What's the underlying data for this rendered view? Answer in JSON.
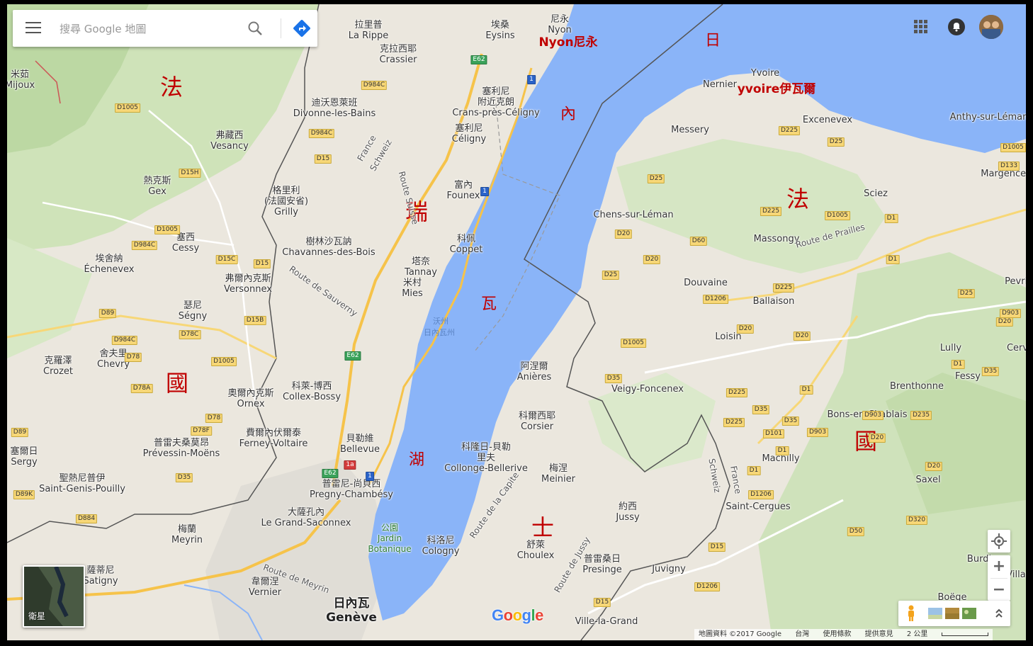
{
  "search": {
    "placeholder": "搜尋 Google 地圖"
  },
  "annotations": {
    "france_left_1": "法",
    "france_left_2": "國",
    "swiss_1": "瑞",
    "swiss_2": "士",
    "geneva_1": "日",
    "geneva_2": "內",
    "geneva_3": "瓦",
    "geneva_4": "湖",
    "france_right_1": "法",
    "france_right_2": "國",
    "nyon": "Nyon尼永",
    "yvoire": "yvoire伊瓦爾"
  },
  "places": {
    "geneva_zh": "日內瓦",
    "geneva": "Genève",
    "nyon_zh": "尼永",
    "nyon": "Nyon",
    "laripe_zh": "拉里普",
    "laripe": "La Rippe",
    "crassier_zh": "克拉西耶",
    "crassier": "Crassier",
    "eysins_zh": "埃桑",
    "eysins": "Eysins",
    "mijoux_zh": "米茹",
    "mijoux": "Mijoux",
    "divonne_zh": "迪沃恩萊班",
    "divonne": "Divonne-les-Bains",
    "crans_zh1": "塞利尼",
    "crans_zh2": "附近克朗",
    "crans": "Crans-près-Céligny",
    "celigny_zh": "塞利尼",
    "celigny": "Céligny",
    "vesancy_zh": "弗藏西",
    "vesancy": "Vesancy",
    "gex_zh": "熱克斯",
    "gex": "Gex",
    "grilly_zh1": "格里利",
    "grilly_zh2": "(法國安省)",
    "grilly": "Grilly",
    "founex_zh": "富內",
    "founex": "Founex",
    "cessy_zh": "塞西",
    "cessy": "Cessy",
    "chavannes_zh": "樹林沙瓦訥",
    "chavannes": "Chavannes-des-Bois",
    "coppet_zh": "科佩",
    "coppet": "Coppet",
    "echenevex_zh": "埃舍納",
    "echenevex": "Échenevex",
    "versonnex_zh": "弗爾內克斯",
    "versonnex": "Versonnex",
    "tannay_zh": "塔奈",
    "tannay": "Tannay",
    "mies_zh": "米村",
    "mies": "Mies",
    "segny_zh": "瑟尼",
    "segny": "Ségny",
    "chevry_zh": "舍夫里",
    "chevry": "Chevry",
    "crozet_zh": "克羅澤",
    "crozet": "Crozet",
    "ornex_zh": "奧爾內克斯",
    "ornex": "Ornex",
    "collex_zh": "科萊-博西",
    "collex": "Collex-Bossy",
    "ferney_zh": "費爾內伏爾泰",
    "ferney": "Ferney-Voltaire",
    "prevessin_zh": "普雷夫桑莫昂",
    "prevessin": "Prévessin-Moëns",
    "sergy_zh": "塞爾日",
    "sergy": "Sergy",
    "bellevue_zh": "貝勒維",
    "bellevue": "Bellevue",
    "stgenis_zh": "聖熱尼普伊",
    "stgenis": "Saint-Genis-Pouilly",
    "pregny_zh": "普雷尼-尚貝西",
    "pregny": "Pregny-Chambésy",
    "saconnex_zh": "大薩孔內",
    "saconnex": "Le Grand-Saconnex",
    "meyrin_zh": "梅蘭",
    "meyrin": "Meyrin",
    "satigny_zh": "薩蒂尼",
    "satigny": "Satigny",
    "vernier_zh": "韋爾涅",
    "vernier": "Vernier",
    "jardin_zh": "公園",
    "jardin": "Jardin Botanique",
    "cologny_zh": "科洛尼",
    "cologny": "Cologny",
    "anieres_zh": "阿涅爾",
    "anieres": "Anières",
    "corsier_zh": "科爾西耶",
    "corsier": "Corsier",
    "collonge_zh1": "科隆日-貝勒",
    "collonge_zh2": "里夫",
    "collonge": "Collonge-Bellerive",
    "meinier_zh": "梅涅",
    "meinier": "Meinier",
    "jussy_zh": "約西",
    "jussy": "Jussy",
    "choulex_zh": "舒萊",
    "choulex": "Choulex",
    "presinge_zh": "普雷桑日",
    "presinge": "Presinge",
    "juvigny": "Juvigny",
    "villelagrand": "Ville-la-Grand",
    "yvoire": "Yvoire",
    "nernier": "Nernier",
    "excenevex": "Excenevex",
    "messery": "Messery",
    "anthy": "Anthy-sur-Léman",
    "margencel": "Margencel",
    "sciez": "Sciez",
    "chens": "Chens-sur-Léman",
    "massongy": "Massongy",
    "douvaine": "Douvaine",
    "ballaison": "Ballaison",
    "loisin": "Loisin",
    "lully": "Lully",
    "veigy": "Veigy-Foncenex",
    "brenthonne": "Brenthonne",
    "fessy": "Fessy",
    "bons": "Bons-en-Chablais",
    "machilly": "Machilly",
    "saxel": "Saxel",
    "stcergues": "Saint-Cergues",
    "boege": "Boëge",
    "burdi": "Burdi",
    "villa": "Villa",
    "cerv": "Cerv",
    "pevrilly": "Pevril"
  },
  "road_labels": {
    "france_border": "France",
    "schweiz": "Schweiz",
    "route_sauverny": "Route de Sauverny",
    "route_prailles": "Route de Prailles",
    "route_capite": "Route de la Capite",
    "route_jussy": "Route de Jussy",
    "route_meyrin": "Route de Meyrin",
    "route_suisse": "Route Suisse",
    "schweiz_right": "Schweiz",
    "france_right": "France",
    "lake_vaud": "沃州",
    "lake_geneva_canton": "日內瓦州"
  },
  "road_shields": [
    "E62",
    "D984C",
    "D1005",
    "D984C",
    "D15",
    "D15H",
    "D1005",
    "D984C",
    "D15C",
    "D15",
    "D15B",
    "D89",
    "D78C",
    "D984C",
    "D78",
    "D1005",
    "D78A",
    "D78",
    "D78F",
    "D89",
    "D35",
    "D89K",
    "D884",
    "E62",
    "1a",
    "E62",
    "1",
    "1",
    "1",
    "D25",
    "D225",
    "D25",
    "D1005",
    "D133",
    "D225",
    "D1005",
    "D20",
    "D60",
    "D20",
    "D25",
    "D1",
    "D1",
    "D1206",
    "D225",
    "D25",
    "D903",
    "D20",
    "D20",
    "D1005",
    "D35",
    "D1",
    "D225",
    "D35",
    "D35",
    "D101",
    "D903",
    "D1",
    "D20",
    "D1",
    "D1206",
    "D20",
    "D50",
    "D320",
    "D15",
    "D1206",
    "D15",
    "D20",
    "D235",
    "D1",
    "D35",
    "D903",
    "D225"
  ],
  "controls": {
    "satellite_label": "衛星",
    "zoom_in": "+",
    "zoom_out": "−"
  },
  "footer": {
    "map_data": "地圖資料 ©2017 Google",
    "region": "台灣",
    "terms": "使用條款",
    "feedback": "提供意見",
    "scale": "2 公里"
  },
  "google_logo": "Google",
  "colors": {
    "water": "#8ab4f8",
    "land": "#e9e5dc",
    "forest": "#c8dfb3",
    "highway": "#f7c64a",
    "annotation_red": "#c00000"
  }
}
